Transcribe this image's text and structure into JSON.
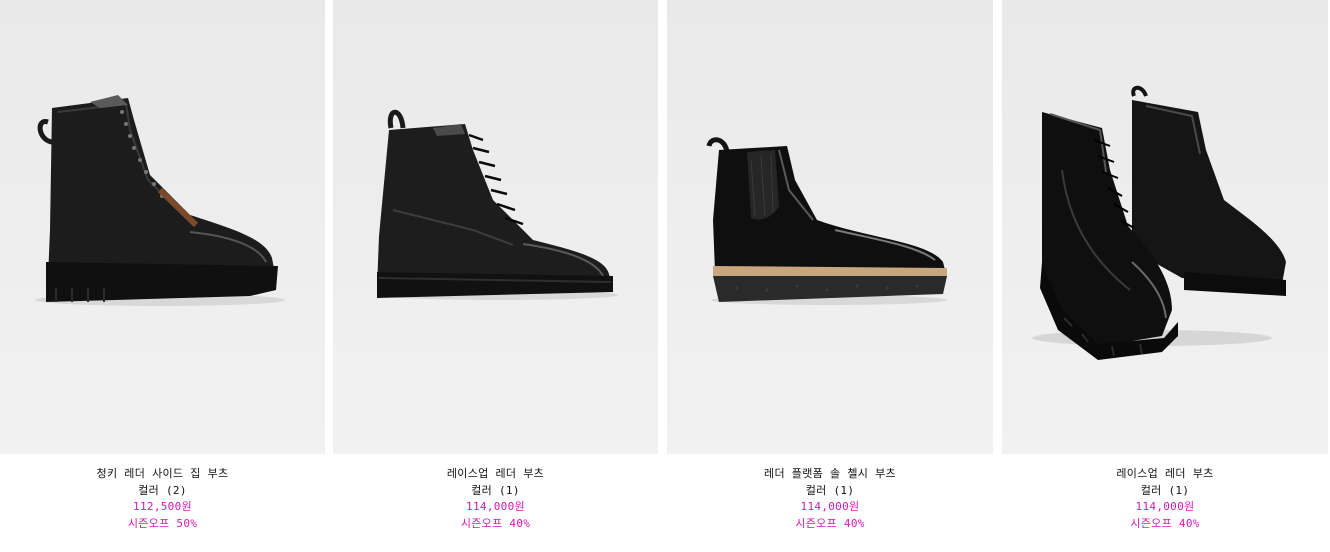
{
  "products": [
    {
      "name": "청키 레더 사이드 집 부츠",
      "colors": "컬러 (2)",
      "price": "112,500원",
      "sale": "시즌오프 50%",
      "image": "chunky-lace-up-boot-icon"
    },
    {
      "name": "레이스업 레더 부츠",
      "colors": "컬러 (1)",
      "price": "114,000원",
      "sale": "시즌오프 40%",
      "image": "lace-up-boot-icon"
    },
    {
      "name": "레더 플랫폼 솔 첼시 부츠",
      "colors": "컬러 (1)",
      "price": "114,000원",
      "sale": "시즌오프 40%",
      "image": "chelsea-boot-icon"
    },
    {
      "name": "레이스업 레더 부츠",
      "colors": "컬러 (1)",
      "price": "114,000원",
      "sale": "시즌오프 40%",
      "image": "pair-of-boots-icon"
    }
  ],
  "colors": {
    "sale_text": "#d419b4",
    "text": "#111111",
    "photo_bg": "#ececec"
  }
}
